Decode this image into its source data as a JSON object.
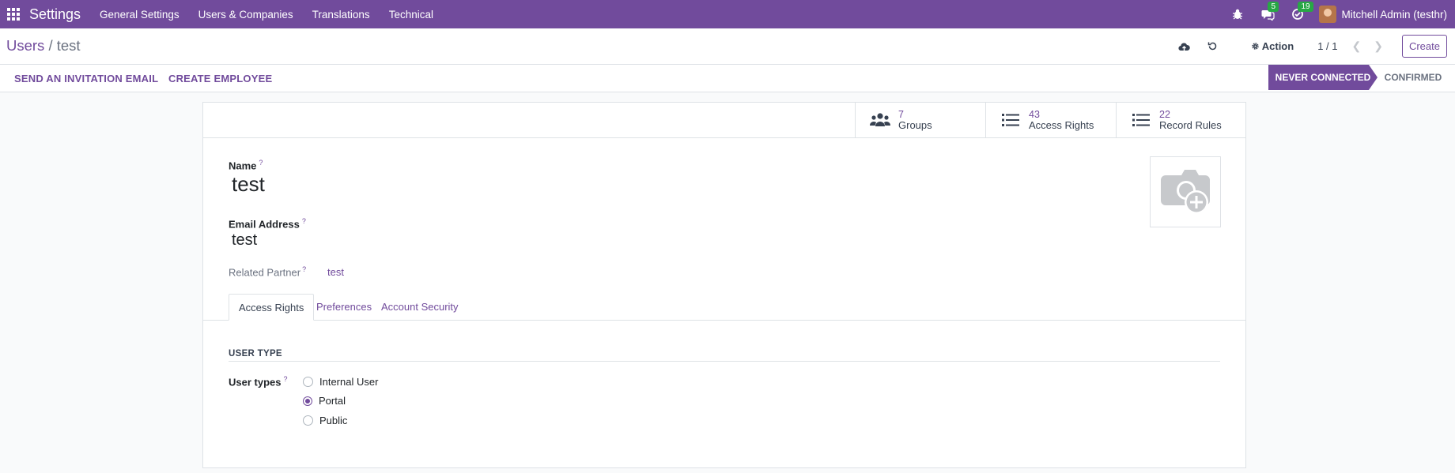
{
  "navbar": {
    "brand": "Settings",
    "menus": [
      "General Settings",
      "Users & Companies",
      "Translations",
      "Technical"
    ],
    "messages_badge": "5",
    "activities_badge": "19",
    "user_name": "Mitchell Admin (testhr)",
    "icons": [
      "apps-grid-icon",
      "bug-icon",
      "chat-icon",
      "clock-check-icon"
    ]
  },
  "control_panel": {
    "breadcrumb_parent": "Users",
    "breadcrumb_sep": " / ",
    "breadcrumb_current": "test",
    "action_label": "Action",
    "pager": "1 / 1",
    "create_label": "Create",
    "icons": [
      "cloud-upload-icon",
      "discard-icon",
      "gear-icon",
      "chevron-left-icon",
      "chevron-right-icon"
    ]
  },
  "statusbar": {
    "buttons": [
      "SEND AN INVITATION EMAIL",
      "CREATE EMPLOYEE"
    ],
    "stages": [
      "NEVER CONNECTED",
      "CONFIRMED"
    ],
    "active_stage": "NEVER CONNECTED"
  },
  "stat_buttons": [
    {
      "value": "7",
      "label": "Groups",
      "icon": "users-icon"
    },
    {
      "value": "43",
      "label": "Access Rights",
      "icon": "list-icon"
    },
    {
      "value": "22",
      "label": "Record Rules",
      "icon": "list-icon"
    }
  ],
  "form": {
    "name_label": "Name",
    "name_value": "test",
    "email_label": "Email Address",
    "email_value": "test",
    "partner_label": "Related Partner",
    "partner_value": "test",
    "help_mark": "?"
  },
  "tabs": [
    "Access Rights",
    "Preferences",
    "Account Security"
  ],
  "active_tab": "Access Rights",
  "user_type": {
    "section_title": "USER TYPE",
    "label": "User types",
    "options": [
      "Internal User",
      "Portal",
      "Public"
    ],
    "selected": "Portal"
  },
  "colors": {
    "brand": "#714b9c",
    "badge": "#28a745"
  }
}
